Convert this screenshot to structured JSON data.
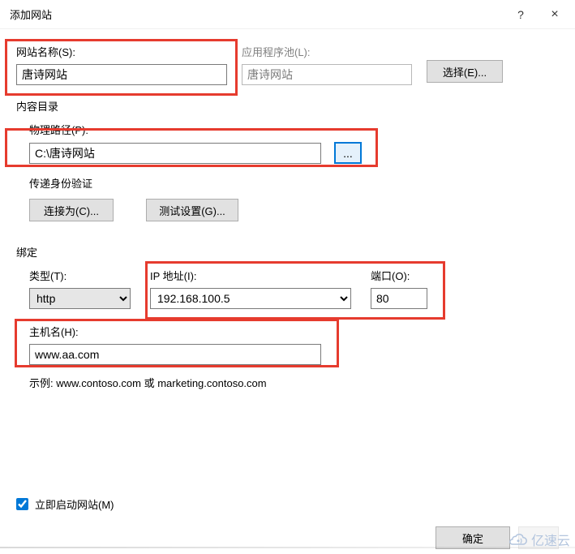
{
  "window": {
    "title": "添加网站",
    "help": "?",
    "close": "×"
  },
  "site_name": {
    "label": "网站名称(S):",
    "value": "唐诗网站"
  },
  "app_pool": {
    "label": "应用程序池(L):",
    "value": "唐诗网站",
    "select_btn": "选择(E)..."
  },
  "content_dir": {
    "title": "内容目录"
  },
  "physical_path": {
    "label": "物理路径(P):",
    "value": "C:\\唐诗网站",
    "browse": "..."
  },
  "passthrough": {
    "title": "传递身份验证",
    "connect_as": "连接为(C)...",
    "test_settings": "测试设置(G)..."
  },
  "binding": {
    "title": "绑定",
    "type_label": "类型(T):",
    "type_value": "http",
    "ip_label": "IP 地址(I):",
    "ip_value": "192.168.100.5",
    "port_label": "端口(O):",
    "port_value": "80"
  },
  "hostname": {
    "label": "主机名(H):",
    "value": "www.aa.com",
    "example": "示例: www.contoso.com 或 marketing.contoso.com"
  },
  "start_immediately": "立即启动网站(M)",
  "footer": {
    "ok": "确定"
  },
  "watermark": "亿速云"
}
